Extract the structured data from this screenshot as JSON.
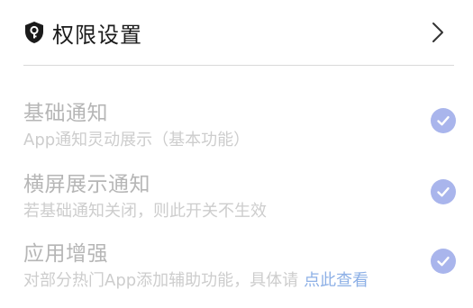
{
  "header": {
    "title": "权限设置",
    "icon": "shield-keyhole-icon",
    "chevron_icon": "chevron-right-icon"
  },
  "items": [
    {
      "title": "基础通知",
      "desc": "App通知灵动展示（基本功能）",
      "checked": true
    },
    {
      "title": "横屏展示通知",
      "desc": "若基础通知关闭，则此开关不生效",
      "checked": true
    },
    {
      "title": "应用增强",
      "desc": "对部分热门App添加辅助功能，具体请",
      "link": "点此查看",
      "checked": true
    }
  ],
  "colors": {
    "check_fill": "#a9b5ec",
    "link": "#8db0e6",
    "disabled_title": "#b6b6b6",
    "disabled_desc": "#cdcdcd"
  }
}
